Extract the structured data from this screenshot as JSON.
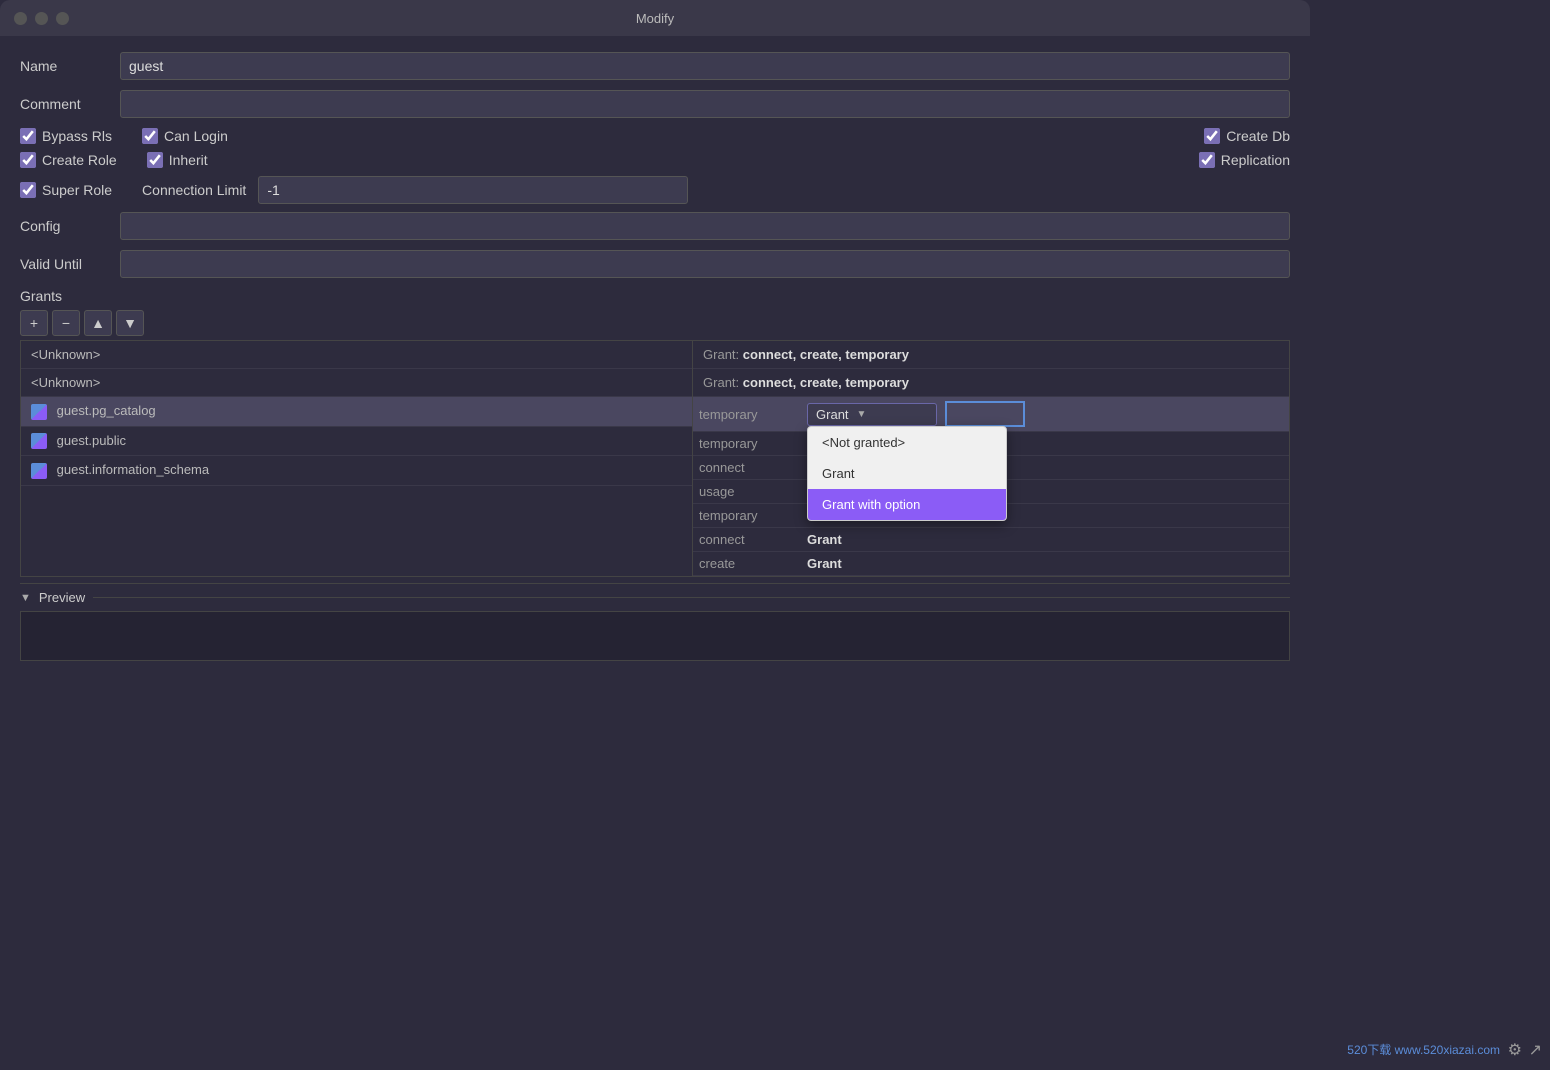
{
  "titlebar": {
    "title": "Modify"
  },
  "form": {
    "name_label": "Name",
    "name_value": "guest",
    "comment_label": "Comment",
    "comment_value": "",
    "bypass_rls_label": "Bypass Rls",
    "bypass_rls_checked": true,
    "can_login_label": "Can Login",
    "can_login_checked": true,
    "create_db_label": "Create Db",
    "create_db_checked": true,
    "create_role_label": "Create Role",
    "create_role_checked": true,
    "inherit_label": "Inherit",
    "inherit_checked": true,
    "replication_label": "Replication",
    "replication_checked": true,
    "super_role_label": "Super Role",
    "super_role_checked": true,
    "conn_limit_label": "Connection Limit",
    "conn_limit_value": "-1",
    "config_label": "Config",
    "config_value": "",
    "valid_until_label": "Valid Until",
    "valid_until_value": ""
  },
  "grants": {
    "section_label": "Grants",
    "toolbar": {
      "add": "+",
      "remove": "−",
      "up": "▲",
      "down": "▼"
    },
    "left_items": [
      {
        "id": "unknown1",
        "label": "<Unknown>",
        "type": "unknown"
      },
      {
        "id": "unknown2",
        "label": "<Unknown>",
        "type": "unknown"
      },
      {
        "id": "pg_catalog",
        "label": "guest.pg_catalog",
        "bold": "pg_catalog",
        "type": "schema",
        "selected": true
      },
      {
        "id": "public",
        "label": "guest.public",
        "bold": "public",
        "type": "schema"
      },
      {
        "id": "information_schema",
        "label": "guest.information_schema",
        "bold": "information_schema",
        "type": "schema"
      }
    ],
    "right_items_unknown": [
      {
        "label": "Grant: connect, create, temporary"
      },
      {
        "label": "Grant: connect, create, temporary"
      }
    ],
    "detail_rows": [
      {
        "priv": "temporary",
        "grant_val": "",
        "has_dropdown": true,
        "dropdown_value": "Grant",
        "show_input": true,
        "selected": true
      },
      {
        "priv": "temporary",
        "grant_val": ""
      },
      {
        "priv": "connect",
        "grant_val": ""
      },
      {
        "priv": "usage",
        "grant_val": ""
      },
      {
        "priv": "temporary",
        "grant_val": "Grant"
      },
      {
        "priv": "connect",
        "grant_val": "Grant"
      },
      {
        "priv": "create",
        "grant_val": "Grant"
      }
    ],
    "dropdown_options": [
      {
        "label": "<Not granted>",
        "active": false
      },
      {
        "label": "Grant",
        "active": false
      },
      {
        "label": "Grant with option",
        "active": true
      }
    ]
  },
  "preview": {
    "label": "Preview",
    "content": ""
  },
  "watermark": "520下载 www.520xiazai.com"
}
